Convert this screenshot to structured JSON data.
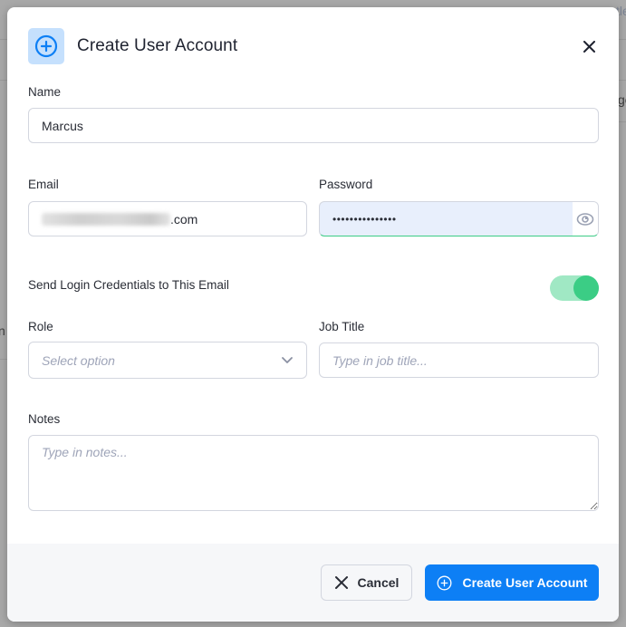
{
  "background": {
    "partial_texts": [
      "tle",
      "ge",
      "n"
    ]
  },
  "modal": {
    "title": "Create User Account",
    "header_icon": "plus-circle-icon",
    "close_icon": "close-icon"
  },
  "form": {
    "name": {
      "label": "Name",
      "value": "Marcus"
    },
    "email": {
      "label": "Email",
      "value_visible_suffix": ".com",
      "value_obscured": true
    },
    "password": {
      "label": "Password",
      "value_masked": "•••••••••••••••",
      "toggle_icon": "eye-icon"
    },
    "send_credentials": {
      "label": "Send Login Credentials to This Email",
      "enabled": true
    },
    "role": {
      "label": "Role",
      "placeholder": "Select option",
      "value": ""
    },
    "job_title": {
      "label": "Job Title",
      "placeholder": "Type in job title...",
      "value": ""
    },
    "notes": {
      "label": "Notes",
      "placeholder": "Type in notes...",
      "value": ""
    }
  },
  "footer": {
    "cancel_label": "Cancel",
    "create_label": "Create User Account"
  },
  "colors": {
    "primary": "#0d7ff5",
    "toggle_on": "#3bcd85",
    "toggle_track": "#a0e8c4",
    "header_icon_bg": "#c5e0fd",
    "autofill_bg": "#e8effc"
  }
}
